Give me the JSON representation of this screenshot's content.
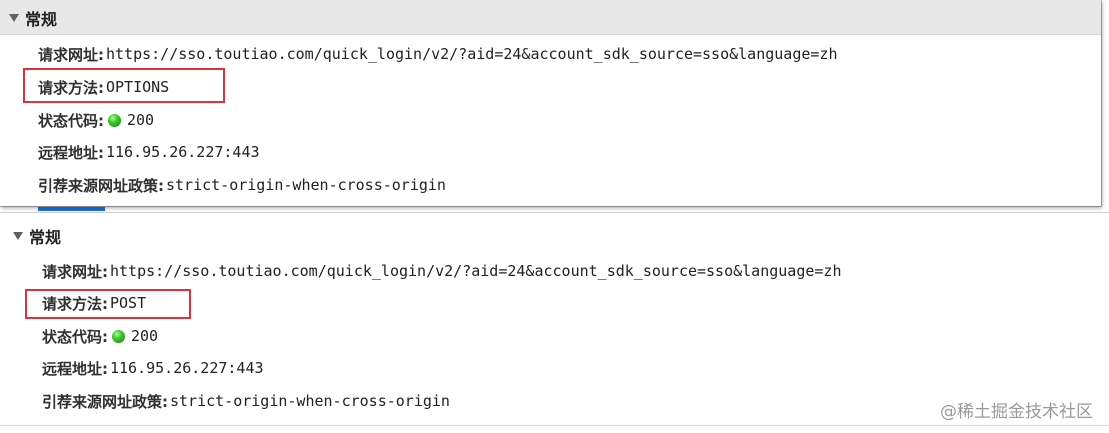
{
  "panels": [
    {
      "title": "常规",
      "request_url_label": "请求网址:",
      "request_url": "https://sso.toutiao.com/quick_login/v2/?aid=24&account_sdk_source=sso&language=zh",
      "method_label": "请求方法:",
      "method": "OPTIONS",
      "status_label": "状态代码:",
      "status_code": "200",
      "status_color": "#2db51f",
      "remote_label": "远程地址:",
      "remote_address": "116.95.26.227:443",
      "referrer_label": "引荐来源网址政策:",
      "referrer_policy": "strict-origin-when-cross-origin"
    },
    {
      "title": "常规",
      "request_url_label": "请求网址:",
      "request_url": "https://sso.toutiao.com/quick_login/v2/?aid=24&account_sdk_source=sso&language=zh",
      "method_label": "请求方法:",
      "method": "POST",
      "status_label": "状态代码:",
      "status_code": "200",
      "status_color": "#2db51f",
      "remote_label": "远程地址:",
      "remote_address": "116.95.26.227:443",
      "referrer_label": "引荐来源网址政策:",
      "referrer_policy": "strict-origin-when-cross-origin"
    }
  ],
  "highlight_color": "#e0303a",
  "watermark": "@稀土掘金技术社区"
}
